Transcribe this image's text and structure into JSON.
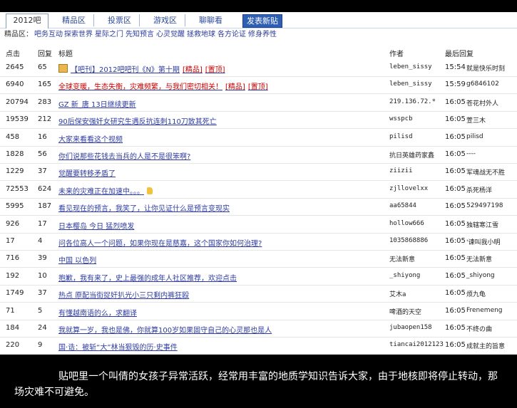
{
  "tabs": [
    {
      "label": "2012吧",
      "active": true
    },
    {
      "label": "精品区"
    },
    {
      "label": "投票区"
    },
    {
      "label": "游戏区"
    },
    {
      "label": "聊聊看"
    },
    {
      "label": "发表新贴",
      "post": true
    }
  ],
  "subnav": {
    "label": "精品区：",
    "items": [
      "吧务互动",
      "探索世界",
      "星际之门",
      "先知预言",
      "心灵觉醒",
      "拯救地球",
      "各方论证",
      "修身养性"
    ]
  },
  "columns": {
    "clicks": "点击",
    "replies": "回复",
    "title": "标题",
    "author": "作者",
    "last_reply": "最后回复"
  },
  "threads": [
    {
      "clicks": "2645",
      "replies": "65",
      "title": "【吧刊】2012吧吧刊《N》第十期",
      "tags": [
        "[精品]",
        "[置顶]"
      ],
      "icon": "book-icon",
      "author": "leben_sissy",
      "time": "15:54",
      "last": "就是快乐时刻"
    },
    {
      "clicks": "6940",
      "replies": "165",
      "title": "全球变暖，生态失衡，灾难频繁，与我们密切相关！",
      "tags": [
        "[精品]",
        "[置顶]"
      ],
      "red": true,
      "author": "leben_sissy",
      "time": "15:59",
      "last": "g6846102"
    },
    {
      "clicks": "20794",
      "replies": "283",
      "title": "GZ 新_唐 13日继续更新",
      "author": "219.136.72.*",
      "time": "16:05",
      "last": "苍花村外人"
    },
    {
      "clicks": "19539",
      "replies": "212",
      "title": "90后保安强奸女研究生遇反抗连刺110刀致其死亡",
      "author": "wsspcb",
      "time": "16:05",
      "last": "萱三木"
    },
    {
      "clicks": "458",
      "replies": "16",
      "title": "大家来看看这个视频",
      "author": "pilisd",
      "time": "16:05",
      "last": "pilisd"
    },
    {
      "clicks": "1828",
      "replies": "56",
      "title": "你们说那些花钱去当兵的人是不是很笨啊?",
      "author": "抗日英雄药家鑫",
      "time": "16:05",
      "last": "----"
    },
    {
      "clicks": "1229",
      "replies": "37",
      "title": "觉醒要转移矛盾了",
      "author": "ziizii",
      "time": "16:05",
      "last": "军魂战无不胜"
    },
    {
      "clicks": "72553",
      "replies": "624",
      "title": "未来的灾难正在加速中。。。",
      "icon_after": "thumbs-up-icon",
      "author": "zjllovelxx",
      "time": "16:05",
      "last": "杀死杨洋"
    },
    {
      "clicks": "5995",
      "replies": "187",
      "title": "看见现在的预言，我笑了，让你见证什么是预言变现实",
      "author": "aa65844",
      "time": "16:05",
      "last": "529497198"
    },
    {
      "clicks": "926",
      "replies": "17",
      "title": "日本樱岛 今日 猛烈喷发",
      "author": "hollow666",
      "time": "16:05",
      "last": "独辖寒江雪"
    },
    {
      "clicks": "17",
      "replies": "4",
      "title": "问各位高人一个问题，如果你现在是慈嘉，这个国家你如何治理?",
      "author": "1035868886",
      "time": "16:05",
      "last": "'谏叫我小明"
    },
    {
      "clicks": "716",
      "replies": "39",
      "title": "中国 以色列",
      "author": "无法新意",
      "time": "16:05",
      "last": "无法新意"
    },
    {
      "clicks": "192",
      "replies": "10",
      "title": "抱歉，我有来了，史上最强的成年人社区推荐，欢迎点击",
      "author": "_shiyong",
      "time": "16:05",
      "last": "_shiyong"
    },
    {
      "clicks": "1749",
      "replies": "37",
      "title": "热点 原配当街捉奸扒光小三只剩内裤狂殴",
      "author": "艾木a",
      "time": "16:05",
      "last": "烦九龟"
    },
    {
      "clicks": "71",
      "replies": "5",
      "title": "有懂越南语的么，求翻译",
      "author": "啤酒的天空",
      "time": "16:05",
      "last": "Frenemeng"
    },
    {
      "clicks": "184",
      "replies": "24",
      "title": "我就算一岁，我也是佛，你就算100岁如果固守自己的心灵那也是人",
      "author": "jubaopen158",
      "time": "16:05",
      "last": "不终の曲"
    },
    {
      "clicks": "220",
      "replies": "9",
      "title": "国·诰：被斩“大”林当狠毁的历·史事件",
      "author": "tiancai2012123",
      "time": "16:05",
      "last": "成就主的旨意"
    }
  ],
  "caption": "贴吧里一个叫倩的女孩子异常活跃，经常用丰富的地质学知识告诉大家，由于地核即将停止转动，那场灾难不可避免。"
}
